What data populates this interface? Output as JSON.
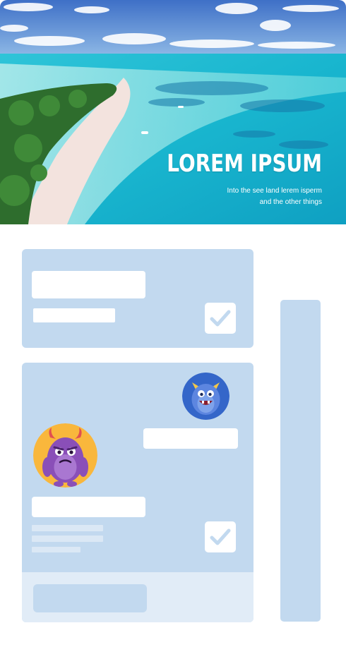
{
  "hero": {
    "title": "LOREM IPSUM",
    "subtitle_line1": "Into the see land  lerem isperm",
    "subtitle_line2": "and the other things"
  },
  "colors": {
    "card": "#c2d9ef",
    "card_footer": "#e1ecf7",
    "placeholder": "#ffffff",
    "check": "#c2d9ef",
    "avatar_blue_bg": "#3466c9",
    "avatar_orange_bg": "#f9b73c"
  },
  "icons": {
    "check": "check-icon",
    "avatar_1": "blue-monster-avatar",
    "avatar_2": "purple-monster-avatar"
  }
}
